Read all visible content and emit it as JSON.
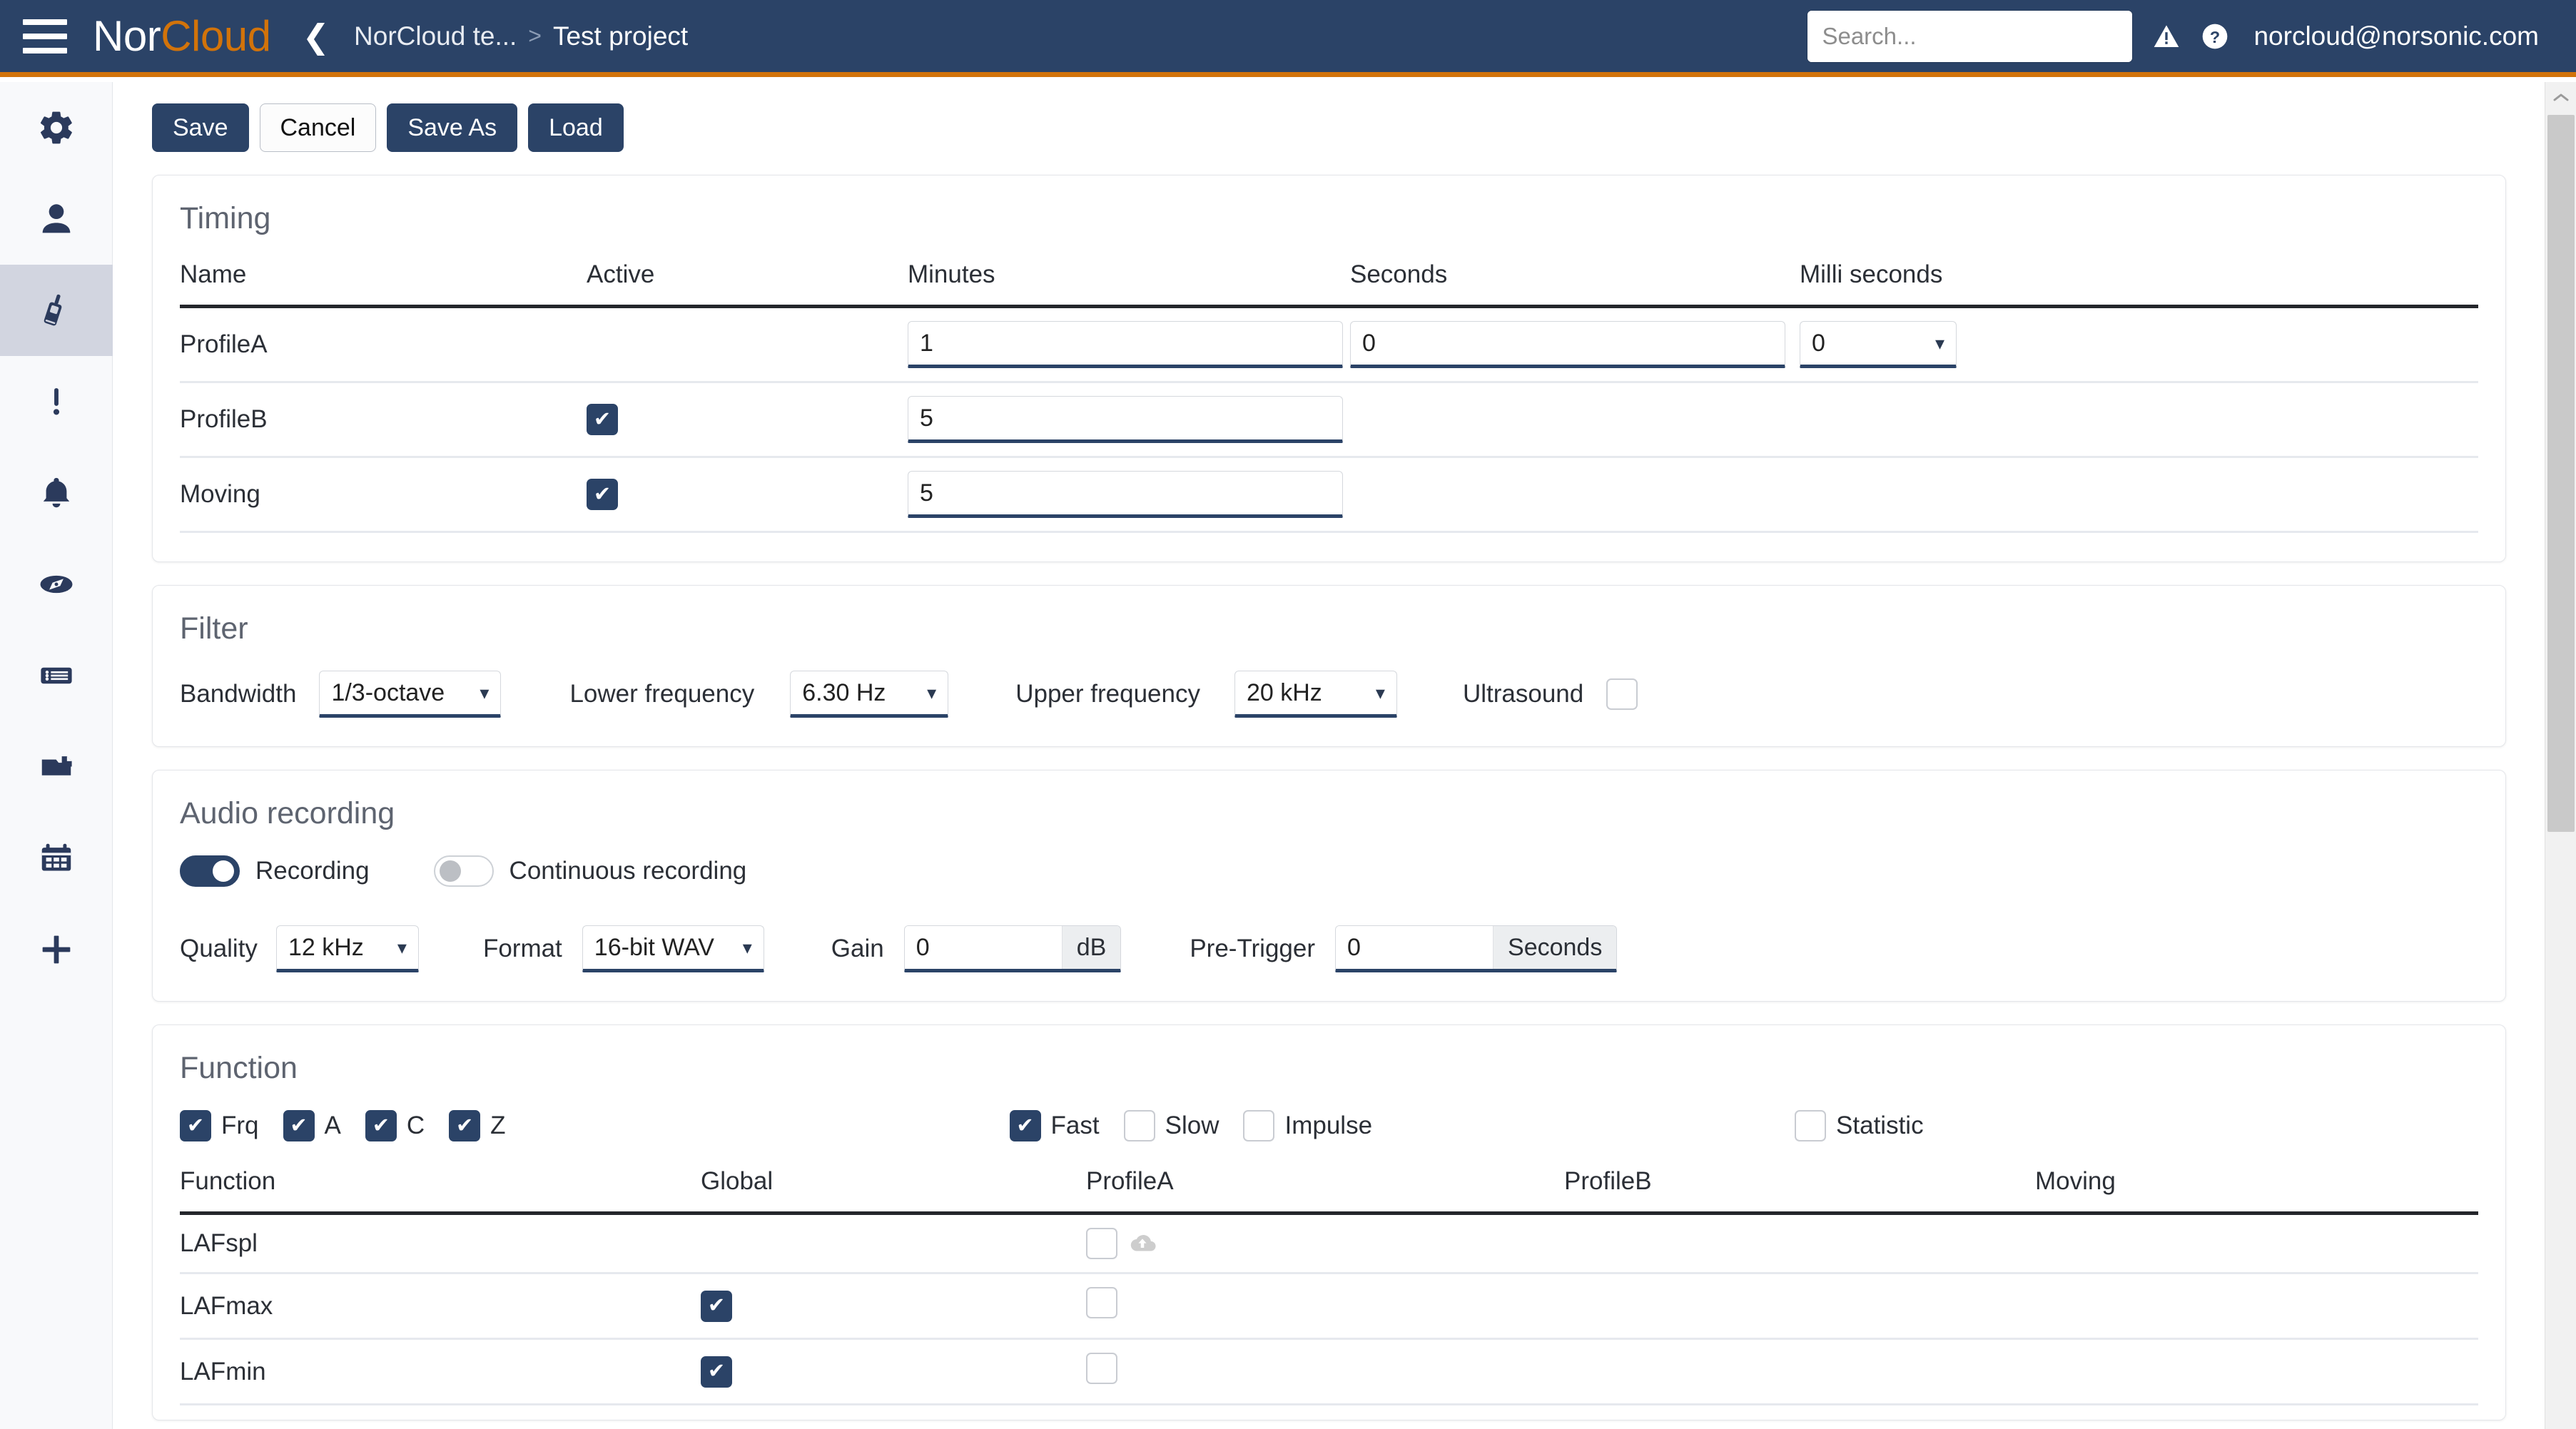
{
  "header": {
    "brand_nor": "Nor",
    "brand_cloud": "Cloud",
    "back_icon": "chevron-left-icon",
    "breadcrumb": {
      "parent": "NorCloud te...",
      "separator": ">",
      "current": "Test project"
    },
    "search": {
      "placeholder": "Search...",
      "value": "",
      "icon": "search-icon"
    },
    "warning_icon": "warning-icon",
    "help_icon": "help-icon",
    "user_email": "norcloud@norsonic.com",
    "bg_color": "#2b4367",
    "accent_color": "#d2730a"
  },
  "sidebar": {
    "items": [
      {
        "name": "settings",
        "icon": "gear-icon",
        "active": false
      },
      {
        "name": "user",
        "icon": "user-icon",
        "active": false
      },
      {
        "name": "instrument",
        "icon": "sound-level-meter-icon",
        "active": true
      },
      {
        "name": "alerts",
        "icon": "exclamation-icon",
        "active": false
      },
      {
        "name": "notifications",
        "icon": "bell-icon",
        "active": false
      },
      {
        "name": "explore",
        "icon": "compass-icon",
        "active": false
      },
      {
        "name": "lists",
        "icon": "list-icon",
        "active": false
      },
      {
        "name": "documents",
        "icon": "file-icon",
        "active": false
      },
      {
        "name": "calendar",
        "icon": "calendar-icon",
        "active": false
      },
      {
        "name": "add",
        "icon": "plus-icon",
        "active": false
      }
    ]
  },
  "toolbar": {
    "save": "Save",
    "cancel": "Cancel",
    "save_as": "Save As",
    "load": "Load"
  },
  "timing": {
    "title": "Timing",
    "columns": [
      "Name",
      "Active",
      "Minutes",
      "Seconds",
      "Milli seconds"
    ],
    "rows": [
      {
        "name": "ProfileA",
        "active": null,
        "minutes": "1",
        "seconds": "0",
        "milliseconds": "0",
        "has_ms_select": true
      },
      {
        "name": "ProfileB",
        "active": true,
        "minutes": "5",
        "seconds": null,
        "milliseconds": null,
        "has_ms_select": false
      },
      {
        "name": "Moving",
        "active": true,
        "minutes": "5",
        "seconds": null,
        "milliseconds": null,
        "has_ms_select": false
      }
    ]
  },
  "filter": {
    "title": "Filter",
    "bandwidth_label": "Bandwidth",
    "bandwidth_value": "1/3-octave",
    "lower_frequency_label": "Lower frequency",
    "lower_frequency_value": "6.30 Hz",
    "upper_frequency_label": "Upper frequency",
    "upper_frequency_value": "20 kHz",
    "ultrasound_label": "Ultrasound",
    "ultrasound_checked": false
  },
  "audio": {
    "title": "Audio recording",
    "recording_label": "Recording",
    "recording_on": true,
    "continuous_label": "Continuous recording",
    "continuous_on": false,
    "quality_label": "Quality",
    "quality_value": "12 kHz",
    "format_label": "Format",
    "format_value": "16-bit WAV",
    "gain_label": "Gain",
    "gain_value": "0",
    "gain_unit": "dB",
    "pretrigger_label": "Pre-Trigger",
    "pretrigger_value": "0",
    "pretrigger_unit": "Seconds"
  },
  "function": {
    "title": "Function",
    "weightings": [
      {
        "label": "Frq",
        "checked": true
      },
      {
        "label": "A",
        "checked": true
      },
      {
        "label": "C",
        "checked": true
      },
      {
        "label": "Z",
        "checked": true
      }
    ],
    "time_constants": [
      {
        "label": "Fast",
        "checked": true
      },
      {
        "label": "Slow",
        "checked": false
      },
      {
        "label": "Impulse",
        "checked": false
      }
    ],
    "statistic": {
      "label": "Statistic",
      "checked": false
    },
    "columns": [
      "Function",
      "Global",
      "ProfileA",
      "ProfileB",
      "Moving"
    ],
    "rows": [
      {
        "name": "LAFspl",
        "global": null,
        "profileA": false,
        "profileB": null,
        "moving": null,
        "cloud_icon": true
      },
      {
        "name": "LAFmax",
        "global": true,
        "profileA": false,
        "profileB": null,
        "moving": null,
        "cloud_icon": false
      },
      {
        "name": "LAFmin",
        "global": true,
        "profileA": false,
        "profileB": null,
        "moving": null,
        "cloud_icon": false
      }
    ]
  },
  "scrollbar": {
    "up_arrow_icon": "chevron-up-icon"
  }
}
